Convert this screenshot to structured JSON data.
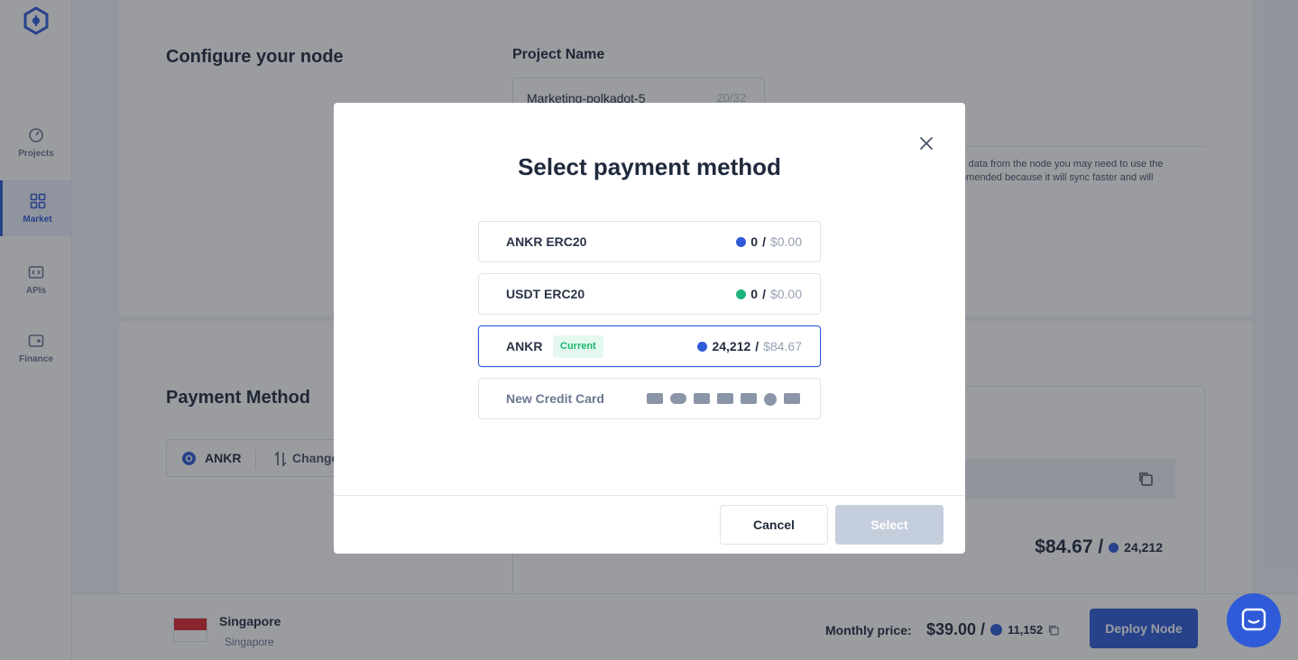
{
  "sidebar": {
    "items": [
      {
        "label": "Projects",
        "icon": "gauge-icon"
      },
      {
        "label": "Market",
        "icon": "grid-icon",
        "active": true
      },
      {
        "label": "APIs",
        "icon": "code-icon"
      },
      {
        "label": "Finance",
        "icon": "wallet-icon"
      }
    ]
  },
  "configure": {
    "title": "Configure your node",
    "project_name_label": "Project Name",
    "project_name_value": "Marketing-polkadot-5",
    "project_name_count": "20/32",
    "desc_line1": "al data from the node you may need to use the",
    "desc_line2": "mmended because it will sync faster and will"
  },
  "payment": {
    "title": "Payment Method",
    "current_method": "ANKR",
    "change_label": "Change"
  },
  "summary": {
    "price": "$84.67 /",
    "tokens": "24,212"
  },
  "footer": {
    "location_name": "Singapore",
    "location_sub": "Singapore",
    "monthly_label": "Monthly price:",
    "monthly_price": "$39.00 /",
    "monthly_tokens": "11,152",
    "deploy_label": "Deploy Node"
  },
  "modal": {
    "title": "Select payment method",
    "options": [
      {
        "name": "ANKR ERC20",
        "amount": "0",
        "usd": "$0.00",
        "coin_color": "#2f5bd8"
      },
      {
        "name": "USDT ERC20",
        "amount": "0",
        "usd": "$0.00",
        "coin_color": "#1fb47e"
      },
      {
        "name": "ANKR",
        "badge": "Current",
        "amount": "24,212",
        "usd": "$84.67",
        "coin_color": "#2f5bd8"
      },
      {
        "name": "New Credit Card"
      }
    ],
    "cancel_label": "Cancel",
    "select_label": "Select"
  },
  "colors": {
    "accent": "#2f5bd8",
    "success": "#18b86e"
  }
}
